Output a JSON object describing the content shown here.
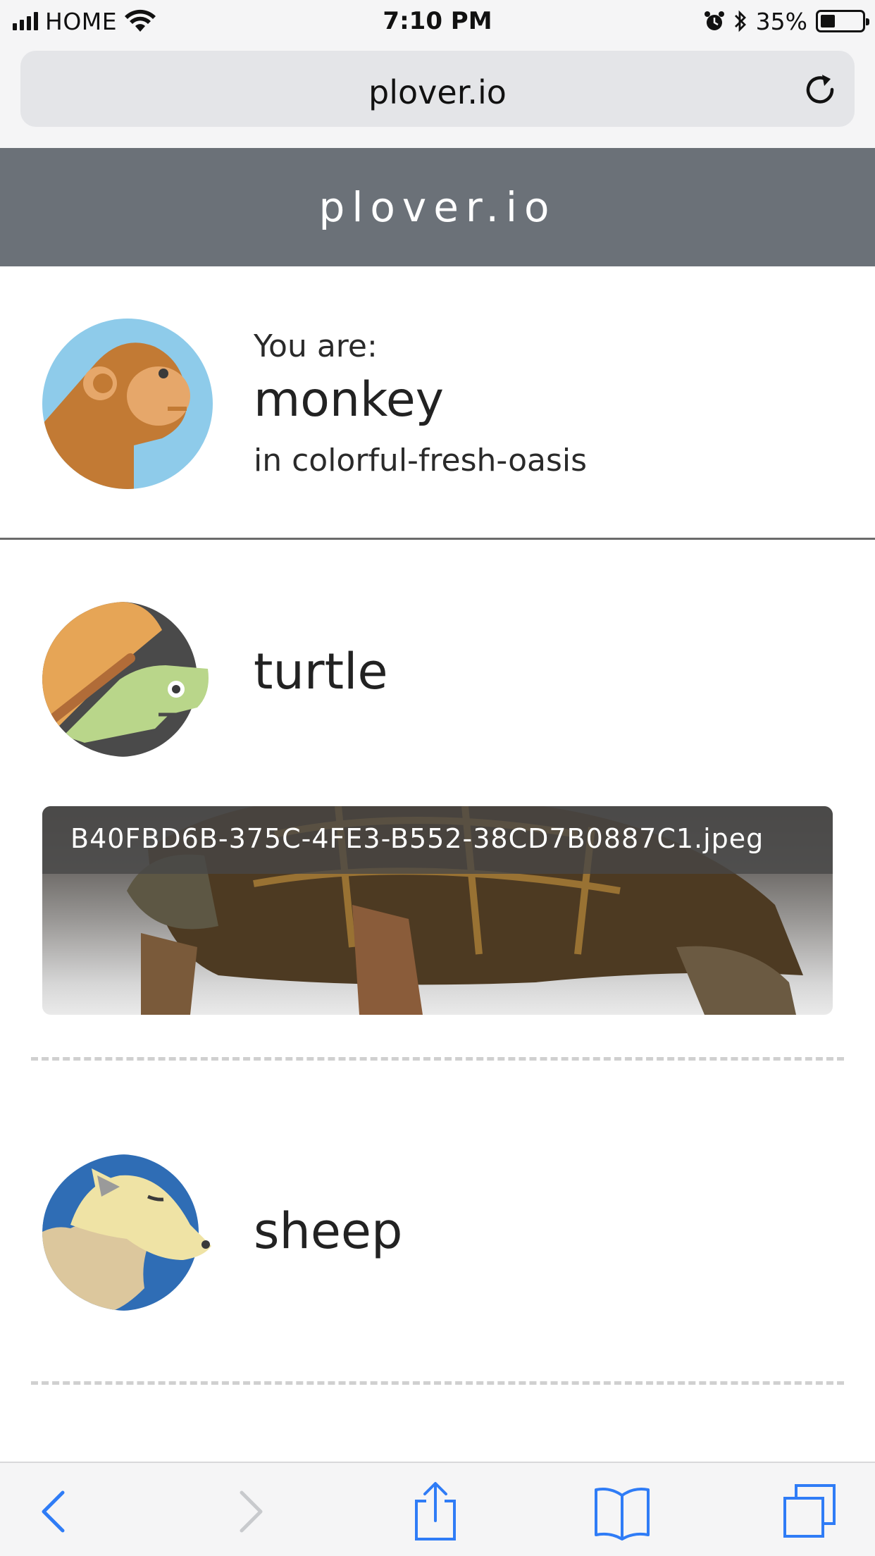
{
  "status_bar": {
    "carrier": "HOME",
    "time": "7:10 PM",
    "battery_percent": "35%",
    "battery_level": 0.35
  },
  "browser": {
    "url": "plover.io"
  },
  "site": {
    "title": "plover.io"
  },
  "me": {
    "prefix": "You are:",
    "name": "monkey",
    "room": "in colorful-fresh-oasis"
  },
  "peers": [
    {
      "name": "turtle",
      "file": "B40FBD6B-375C-4FE3-B552-38CD7B0887C1.jpeg"
    },
    {
      "name": "sheep"
    }
  ],
  "colors": {
    "header_bg": "#6b7178",
    "ios_blue": "#2f7cf6",
    "monkey_bg": "#8ecbea",
    "turtle_bg": "#4a4a4a",
    "sheep_bg": "#2f6db5"
  },
  "icons": {
    "reload": "reload-icon",
    "back": "back-icon",
    "forward": "forward-icon",
    "share": "share-icon",
    "bookmarks": "bookmarks-icon",
    "tabs": "tabs-icon"
  }
}
